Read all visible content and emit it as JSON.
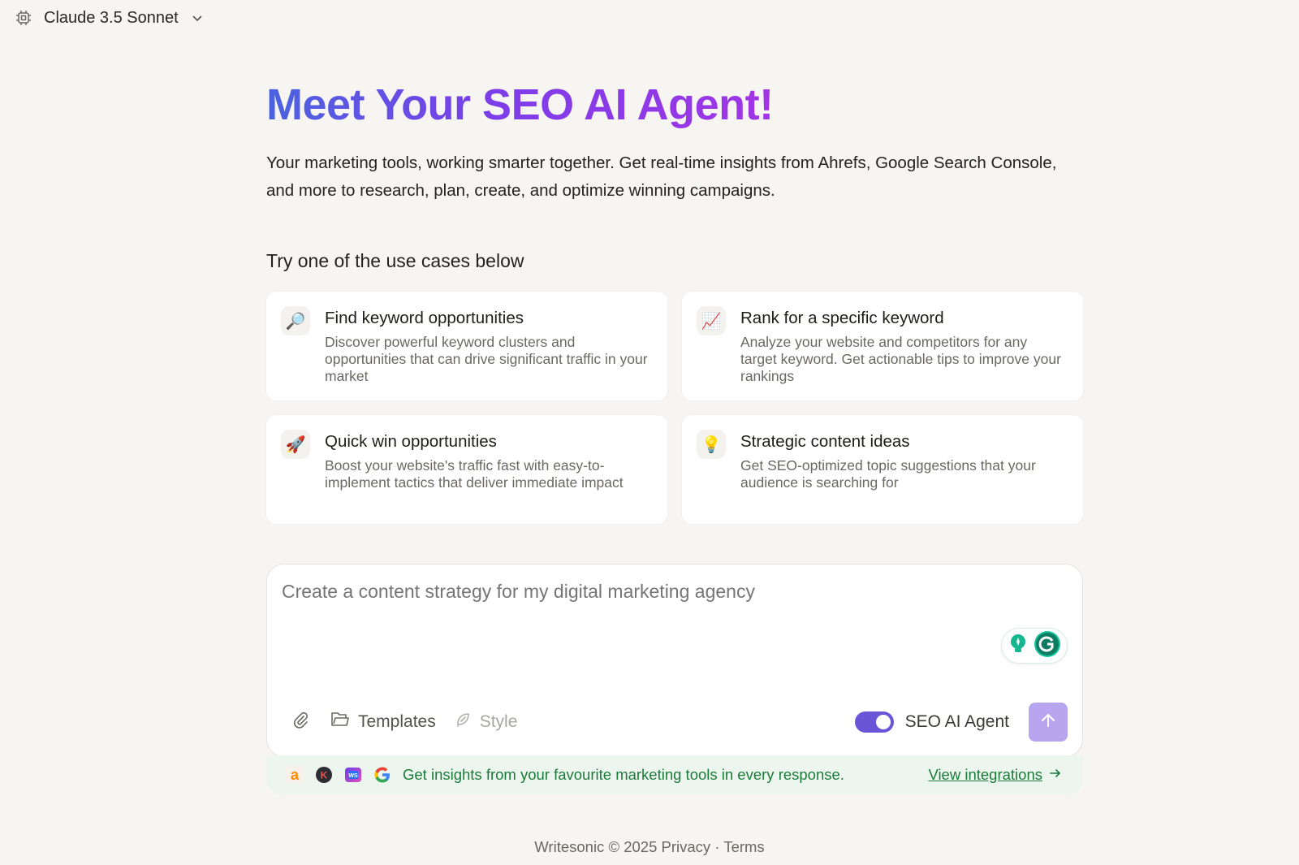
{
  "header": {
    "model_name": "Claude 3.5 Sonnet",
    "model_icon": "cpu-chip-icon"
  },
  "hero": {
    "title": "Meet Your SEO AI Agent!",
    "subtitle": "Your marketing tools, working smarter together. Get real-time insights from Ahrefs, Google Search Console, and more to research, plan, create, and optimize winning campaigns.",
    "gradient": [
      "#4a63e0",
      "#7c3ee8",
      "#a235e6"
    ]
  },
  "use_cases": {
    "label": "Try one of the use cases below",
    "items": [
      {
        "icon": "magnifying-glass-icon",
        "emoji": "🔎",
        "title": "Find keyword opportunities",
        "description": "Discover powerful keyword clusters and opportunities that can drive significant traffic in your market"
      },
      {
        "icon": "chart-increasing-icon",
        "emoji": "📈",
        "title": "Rank for a specific keyword",
        "description": "Analyze your website and competitors for any target keyword. Get actionable tips to improve your rankings"
      },
      {
        "icon": "rocket-icon",
        "emoji": "🚀",
        "title": "Quick win opportunities",
        "description": "Boost your website's traffic fast with easy-to-implement tactics that deliver immediate impact"
      },
      {
        "icon": "light-bulb-icon",
        "emoji": "💡",
        "title": "Strategic content ideas",
        "description": "Get SEO-optimized topic suggestions that your audience is searching for"
      }
    ]
  },
  "composer": {
    "placeholder": "Create a content strategy for my digital marketing agency",
    "templates_label": "Templates",
    "style_label": "Style",
    "agent_toggle_label": "SEO AI Agent",
    "agent_toggle_on": true,
    "accent": "#6a55d9",
    "send_color": "#b7a6ef"
  },
  "integrations": {
    "text": "Get insights from your favourite marketing tools in every response.",
    "link": "View integrations",
    "icons": [
      "ahrefs-icon",
      "k-badge-icon",
      "ws-badge-icon",
      "google-icon"
    ],
    "color": "#1c7a3a"
  },
  "footer": {
    "brand": "Writesonic © 2025",
    "privacy": "Privacy",
    "separator": "·",
    "terms": "Terms"
  }
}
